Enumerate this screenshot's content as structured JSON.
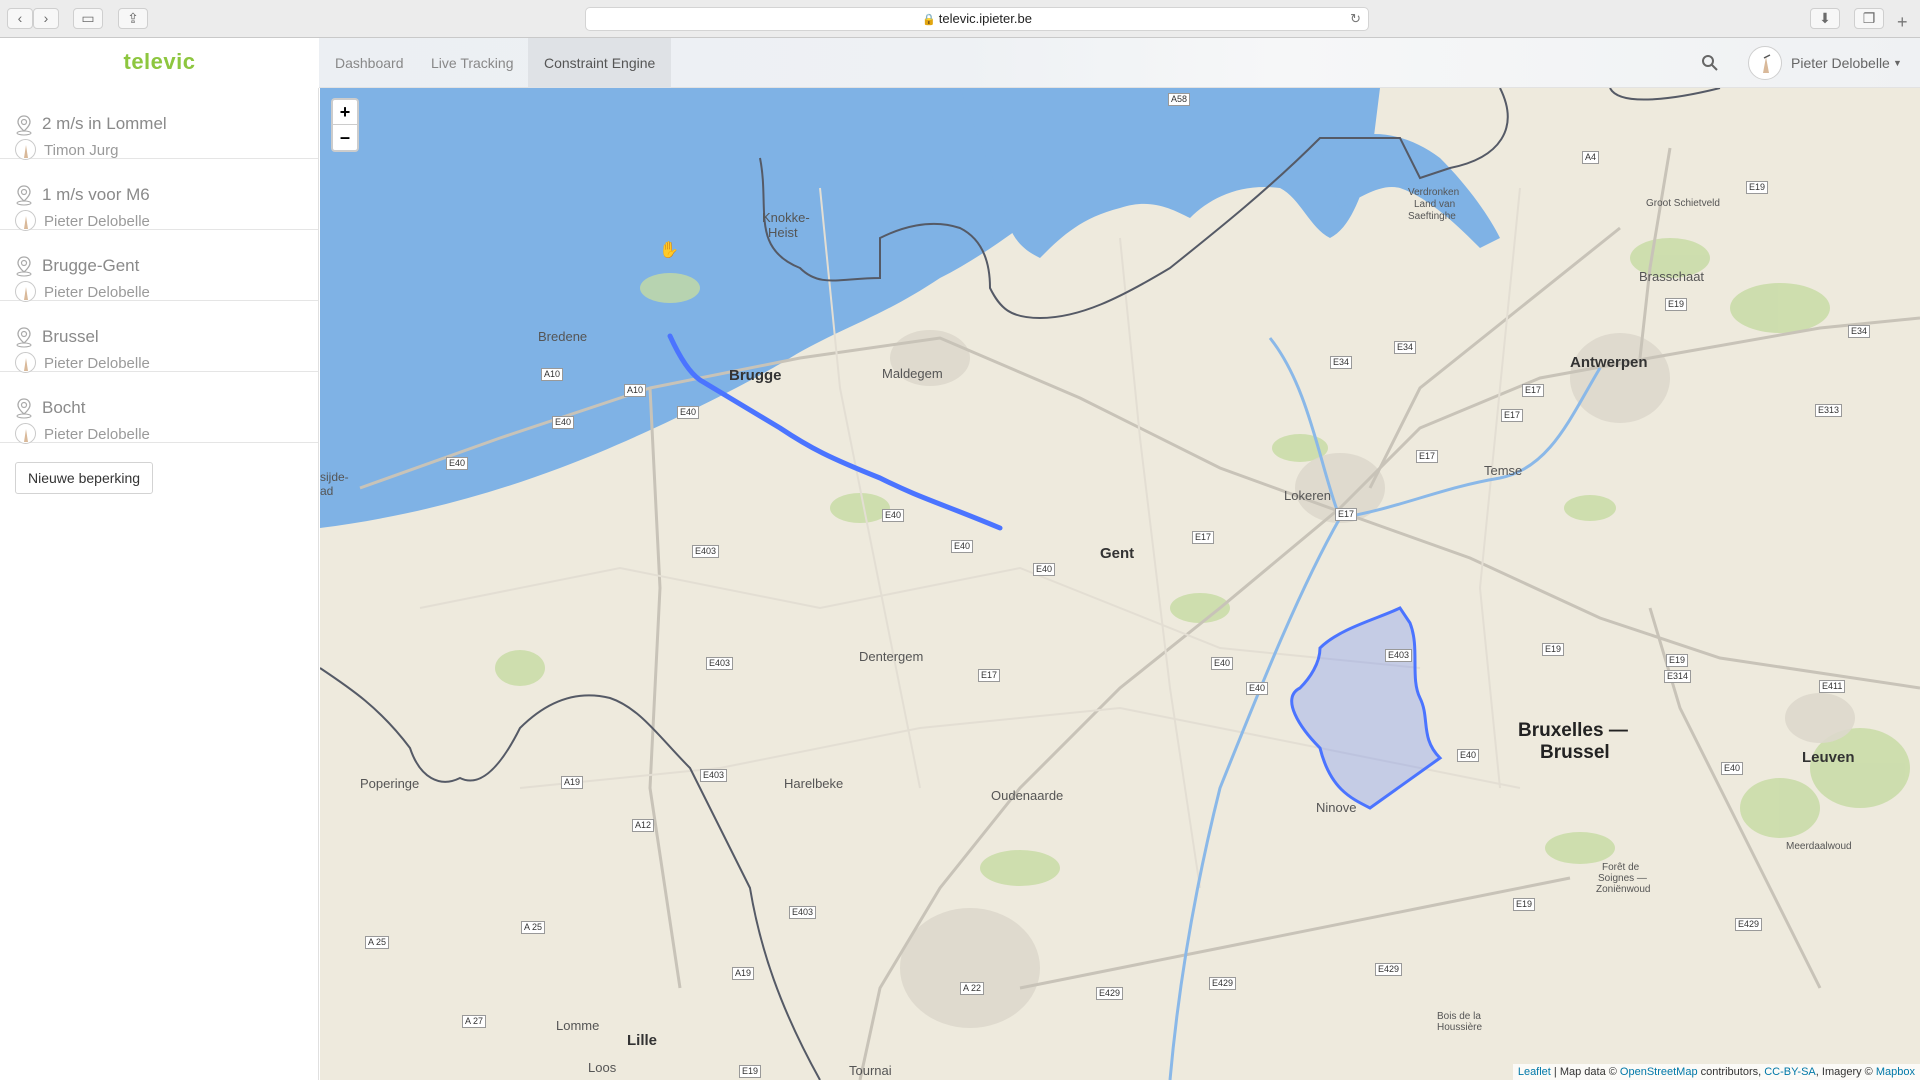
{
  "browser": {
    "url": "televic.ipieter.be",
    "lock_icon": "lock-icon",
    "reload_icon": "reload-icon"
  },
  "app": {
    "logo": "televic",
    "logo_color": "#8dc63f"
  },
  "nav": {
    "tabs": [
      {
        "label": "Dashboard"
      },
      {
        "label": "Live Tracking"
      },
      {
        "label": "Constraint Engine",
        "active": true
      }
    ]
  },
  "user": {
    "name": "Pieter Delobelle"
  },
  "constraints": [
    {
      "title": "2 m/s in Lommel",
      "owner": "Timon Jurg"
    },
    {
      "title": "1 m/s voor M6",
      "owner": "Pieter Delobelle"
    },
    {
      "title": "Brugge-Gent",
      "owner": "Pieter Delobelle"
    },
    {
      "title": "Brussel",
      "owner": "Pieter Delobelle"
    },
    {
      "title": "Bocht",
      "owner": "Pieter Delobelle"
    }
  ],
  "new_constraint_label": "Nieuwe beperking",
  "map": {
    "zoom_in": "+",
    "zoom_out": "–",
    "route_color": "#4b74ff",
    "sea_color": "#7fb2e5",
    "cities": {
      "brugge": "Brugge",
      "gent": "Gent",
      "antwerpen": "Antwerpen",
      "bruxelles_1": "Bruxelles —",
      "bruxelles_2": "Brussel",
      "leuven": "Leuven",
      "lille": "Lille",
      "knokke_1": "Knokke-",
      "knokke_2": "Heist",
      "bredene": "Bredene",
      "maldegem": "Maldegem",
      "lokeren": "Lokeren",
      "temse": "Temse",
      "brasschaat": "Brasschaat",
      "dentergem": "Dentergem",
      "harelbeke": "Harelbeke",
      "oudenaarde": "Oudenaarde",
      "ninove": "Ninove",
      "poperinge": "Poperinge",
      "lomme": "Lomme",
      "loos": "Loos",
      "tournai": "Tournai",
      "groot_schietveld": "Groot Schietveld",
      "verdronken_1": "Verdronken",
      "verdronken_2": "Land van",
      "verdronken_3": "Saeftinghe",
      "meerdaalwoud": "Meerdaalwoud",
      "foret_1": "Forêt de",
      "foret_2": "Soignes —",
      "foret_3": "Zoniënwoud",
      "bois_1": "Bois de la",
      "bois_2": "Houssière",
      "sijde_1": "sijde-",
      "sijde_2": "ad"
    },
    "roads": [
      "A58",
      "A4",
      "E19",
      "E19",
      "E34",
      "E34",
      "E34",
      "E313",
      "E17",
      "E17",
      "E17",
      "E17",
      "E17",
      "E17",
      "A10",
      "A10",
      "E40",
      "E40",
      "E40",
      "E40",
      "E40",
      "E40",
      "E40",
      "E40",
      "E40",
      "E40",
      "E403",
      "E403",
      "E403",
      "E403",
      "E403",
      "A19",
      "A19",
      "A12",
      "E19",
      "E19",
      "E314",
      "E411",
      "E429",
      "E429",
      "E429",
      "E429",
      "A 22",
      "A 25",
      "A 25",
      "A 27",
      "E19",
      "E19"
    ],
    "attribution": {
      "leaflet": "Leaflet",
      "sep1": " | Map data © ",
      "osm": "OpenStreetMap",
      "contrib": " contributors, ",
      "ccbysa": "CC-BY-SA",
      "imagery": ", Imagery © ",
      "mapbox": "Mapbox"
    }
  }
}
